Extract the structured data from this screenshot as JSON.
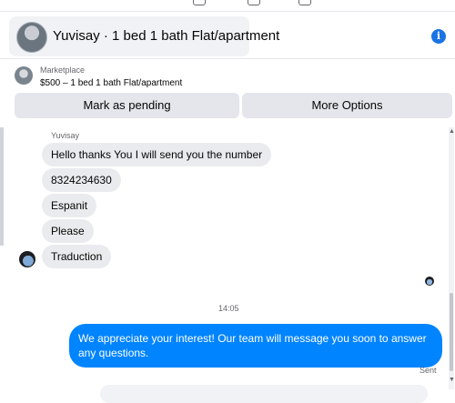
{
  "header": {
    "title": "Yuvisay · 1 bed 1 bath Flat/apartment"
  },
  "marketplace": {
    "label": "Marketplace",
    "listing": "$500 – 1 bed 1 bath Flat/apartment"
  },
  "actions": {
    "pending_label": "Mark as pending",
    "options_label": "More Options"
  },
  "conversation": {
    "sender": "Yuvisay",
    "messages": [
      "Hello thanks You I will send you the number",
      "8324234630",
      "Espanit",
      "Please",
      "Traduction"
    ],
    "timestamp": "14:05",
    "outgoing": "We appreciate your interest! Our team will message you soon to answer any questions.",
    "status": "Sent"
  },
  "colors": {
    "accent": "#0084ff",
    "bubble_in": "#e9ebee",
    "button": "#e4e6eb"
  },
  "icons": {
    "info": "info-icon",
    "avatar": "avatar"
  }
}
